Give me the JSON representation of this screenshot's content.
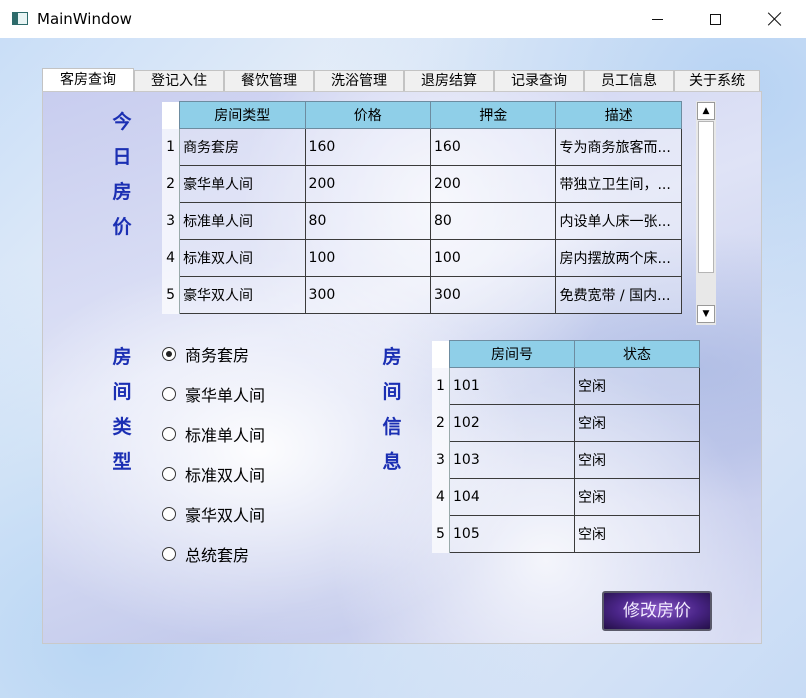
{
  "window": {
    "title": "MainWindow"
  },
  "tabs": [
    "客房查询",
    "登记入住",
    "餐饮管理",
    "洗浴管理",
    "退房结算",
    "记录查询",
    "员工信息",
    "关于系统"
  ],
  "labels": {
    "today_price": [
      "今",
      "日",
      "房",
      "价"
    ],
    "room_type": [
      "房",
      "间",
      "类",
      "型"
    ],
    "room_info": [
      "房",
      "间",
      "信",
      "息"
    ]
  },
  "price_table": {
    "headers": [
      "房间类型",
      "价格",
      "押金",
      "描述"
    ],
    "rows": [
      [
        "1",
        "商务套房",
        "160",
        "160",
        "专为商务旅客而..."
      ],
      [
        "2",
        "豪华单人间",
        "200",
        "200",
        "带独立卫生间，..."
      ],
      [
        "3",
        "标准单人间",
        "80",
        "80",
        "内设单人床一张..."
      ],
      [
        "4",
        "标准双人间",
        "100",
        "100",
        "房内摆放两个床..."
      ],
      [
        "5",
        "豪华双人间",
        "300",
        "300",
        "免费宽带 / 国内..."
      ]
    ]
  },
  "room_types": [
    {
      "label": "商务套房",
      "checked": true
    },
    {
      "label": "豪华单人间",
      "checked": false
    },
    {
      "label": "标准单人间",
      "checked": false
    },
    {
      "label": "标准双人间",
      "checked": false
    },
    {
      "label": "豪华双人间",
      "checked": false
    },
    {
      "label": "总统套房",
      "checked": false
    }
  ],
  "room_table": {
    "headers": [
      "房间号",
      "状态"
    ],
    "rows": [
      [
        "1",
        "101",
        "空闲"
      ],
      [
        "2",
        "102",
        "空闲"
      ],
      [
        "3",
        "103",
        "空闲"
      ],
      [
        "4",
        "104",
        "空闲"
      ],
      [
        "5",
        "105",
        "空闲"
      ]
    ]
  },
  "modify_button": "修改房价"
}
